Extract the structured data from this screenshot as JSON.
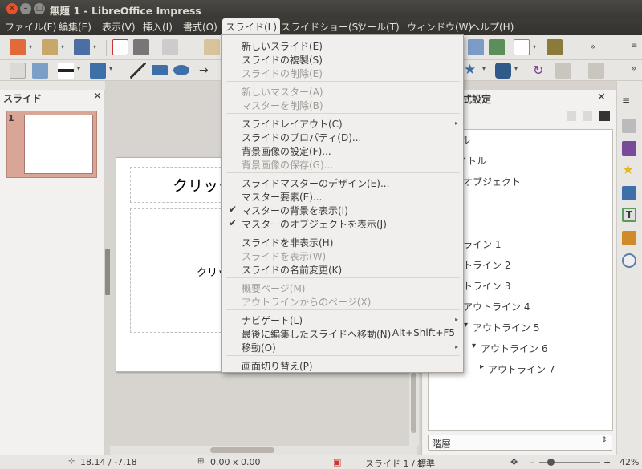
{
  "window": {
    "title": "無題 1 - LibreOffice Impress",
    "close": "✕",
    "minimize": "–",
    "maximize": "□"
  },
  "menubar": [
    "ファイル(F)",
    "編集(E)",
    "表示(V)",
    "挿入(I)",
    "書式(O)",
    "スライド(L)",
    "スライドショー(S)",
    "ツール(T)",
    "ウィンドウ(W)",
    "ヘルプ(H)"
  ],
  "slide_menu": {
    "items": [
      {
        "label": "新しいスライド(E)",
        "enabled": true
      },
      {
        "label": "スライドの複製(S)",
        "enabled": true
      },
      {
        "label": "スライドの削除(E)",
        "enabled": false
      },
      {
        "label": "新しいマスター(A)",
        "enabled": false
      },
      {
        "label": "マスターを削除(B)",
        "enabled": false
      },
      {
        "label": "スライドレイアウト(C)",
        "enabled": true,
        "submenu": true
      },
      {
        "label": "スライドのプロパティ(D)...",
        "enabled": true
      },
      {
        "label": "背景画像の設定(F)...",
        "enabled": true
      },
      {
        "label": "背景画像の保存(G)...",
        "enabled": false
      },
      {
        "label": "スライドマスターのデザイン(E)...",
        "enabled": true
      },
      {
        "label": "マスター要素(E)...",
        "enabled": true
      },
      {
        "label": "マスターの背景を表示(I)",
        "enabled": true,
        "checked": true
      },
      {
        "label": "マスターのオブジェクトを表示(J)",
        "enabled": true,
        "checked": true
      },
      {
        "label": "スライドを非表示(H)",
        "enabled": true
      },
      {
        "label": "スライドを表示(W)",
        "enabled": false
      },
      {
        "label": "スライドの名前変更(K)",
        "enabled": true
      },
      {
        "label": "概要ページ(M)",
        "enabled": false
      },
      {
        "label": "アウトラインからのページ(X)",
        "enabled": false
      },
      {
        "label": "ナビゲート(L)",
        "enabled": true,
        "submenu": true
      },
      {
        "label": "最後に編集したスライドへ移動(N)",
        "enabled": true,
        "shortcut": "Alt+Shift+F5"
      },
      {
        "label": "移動(O)",
        "enabled": true,
        "submenu": true
      },
      {
        "label": "画面切り替え(P)",
        "enabled": true
      }
    ],
    "check_glyph": "✔",
    "submenu_glyph": "▸"
  },
  "left_panel": {
    "title": "スライド",
    "close": "✕",
    "thumb_number": "1"
  },
  "slide": {
    "title_placeholder": "クリック",
    "body_placeholder": "クリッ"
  },
  "right_panel": {
    "title": "ッと書式設定",
    "close": "✕",
    "styles": [
      "ル",
      "イトル",
      "のオブジェクト",
      "ライン 1",
      "トライン 2",
      "トライン 3",
      "アウトライン 4",
      "アウトライン 5",
      "アウトライン 6",
      "アウトライン 7"
    ],
    "filter": "階層",
    "expand_glyph_open": "▾",
    "expand_glyph_closed": "▸"
  },
  "statusbar": {
    "position": "18.14 / -7.18",
    "size": "0.00 x 0.00",
    "slide": "スライド 1 / 1",
    "layout": "標準",
    "zoom": "42%"
  },
  "colors": {
    "menubar_bg": "#3d3c38",
    "accent": "#d9a596",
    "menu_bg": "#f0efed"
  },
  "icons": [
    "ubuntu-close-icon",
    "minimize-icon",
    "maximize-icon",
    "new-doc-icon",
    "open-icon",
    "save-icon",
    "pdf-icon",
    "print-icon",
    "cut-icon",
    "paste-icon",
    "select-arrow-icon",
    "zoom-icon",
    "line-style-icon",
    "fill-icon",
    "line-icon",
    "rectangle-icon",
    "ellipse-icon",
    "arrow-icon",
    "star-icon",
    "shape-icon",
    "rotate-icon",
    "align-icon",
    "properties-icon",
    "styles-icon",
    "gallery-icon",
    "navigator-icon",
    "slide-transition-icon",
    "animation-icon",
    "master-pages-icon",
    "compass-icon"
  ]
}
